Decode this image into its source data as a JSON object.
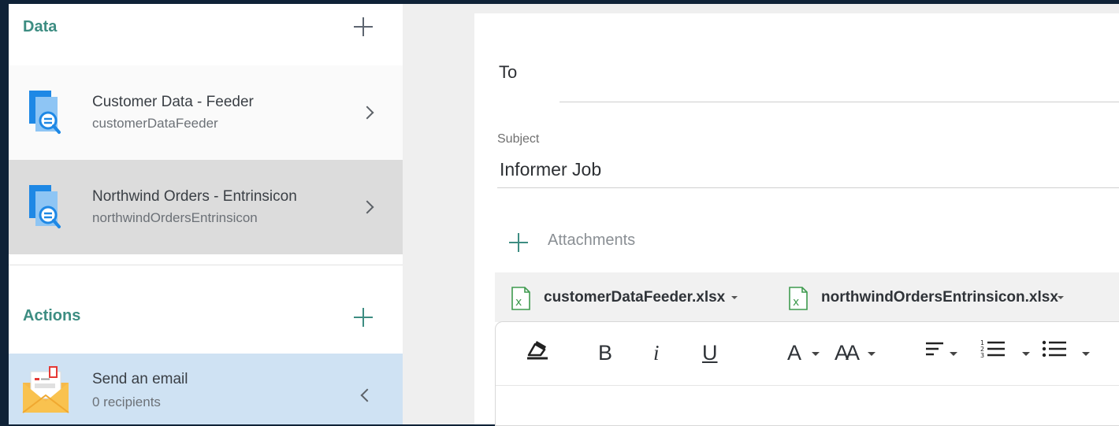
{
  "sidebar": {
    "data_section": {
      "title": "Data",
      "items": [
        {
          "title": "Customer Data - Feeder",
          "subtitle": "customerDataFeeder"
        },
        {
          "title": "Northwind Orders - Entrinsicon",
          "subtitle": "northwindOrdersEntrinsicon"
        }
      ]
    },
    "actions_section": {
      "title": "Actions",
      "items": [
        {
          "title": "Send an email",
          "subtitle": "0 recipients"
        }
      ]
    }
  },
  "email": {
    "to_label": "To",
    "to_value": "",
    "subject_label": "Subject",
    "subject_value": "Informer Job",
    "attachments_label": "Attachments",
    "attachments": [
      {
        "filename": "customerDataFeeder.xlsx"
      },
      {
        "filename": "northwindOrdersEntrinsicon.xlsx"
      }
    ],
    "toolbar": {
      "bold": "B",
      "italic": "i",
      "underline": "U",
      "font_color": "A",
      "font_size": "AA"
    }
  },
  "colors": {
    "accent": "#3d8d82",
    "selected_row": "#dcdcdc",
    "active_action": "#cfe2f3",
    "background": "#0f2237"
  },
  "icons": [
    "add-icon",
    "datasource-search-icon",
    "chevron-right-icon",
    "chevron-left-icon",
    "envelope-icon",
    "excel-file-icon",
    "clear-format-icon",
    "align-icon",
    "ordered-list-icon",
    "bullet-list-icon"
  ]
}
